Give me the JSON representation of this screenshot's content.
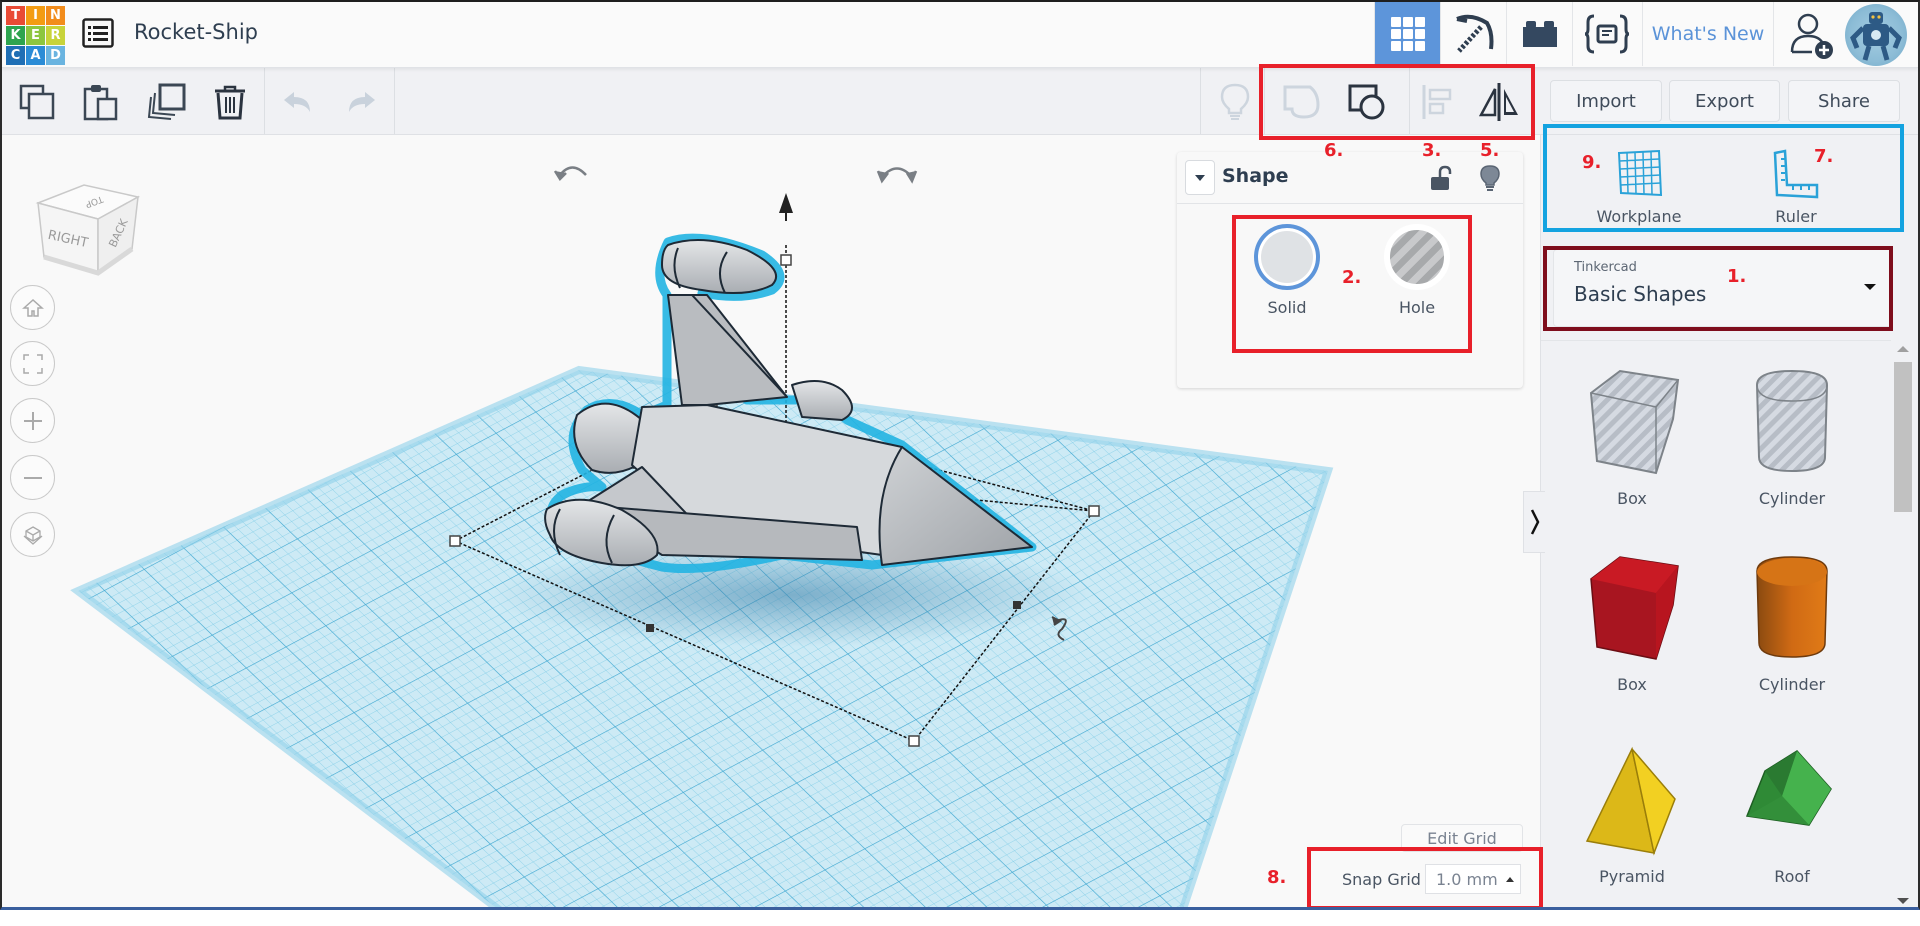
{
  "app": {
    "logo_letters": [
      "T",
      "I",
      "N",
      "K",
      "E",
      "R",
      "C",
      "A",
      "D"
    ],
    "logo_colors": [
      "#e94b35",
      "#f39c12",
      "#f28c1b",
      "#2ea44f",
      "#8dc63f",
      "#c8d33a",
      "#1f6fb5",
      "#2b8cd6",
      "#6ab4e0"
    ],
    "design_title": "Rocket-Ship"
  },
  "topbar": {
    "views": [
      {
        "name": "3d-design",
        "icon": "grid-icon",
        "active": true
      },
      {
        "name": "build-mode",
        "icon": "pickaxe-icon",
        "active": false
      },
      {
        "name": "bricks",
        "icon": "brick-icon",
        "active": false
      },
      {
        "name": "codeblocks",
        "icon": "code-icon",
        "active": false
      }
    ],
    "whats_new": "What's New",
    "accent": "#5d95da"
  },
  "toolbar": {
    "left_tools": [
      "copy",
      "paste",
      "duplicate",
      "delete",
      "undo",
      "redo"
    ],
    "right_tools": [
      "show-all",
      "group",
      "ungroup",
      "align",
      "mirror"
    ],
    "import_label": "Import",
    "export_label": "Export",
    "share_label": "Share"
  },
  "view_cube": {
    "faces": [
      "TOP",
      "RIGHT",
      "BACK"
    ]
  },
  "nav_controls": [
    "home",
    "fit-all",
    "zoom-in",
    "zoom-out",
    "perspective"
  ],
  "shape_panel": {
    "title": "Shape",
    "solid_label": "Solid",
    "hole_label": "Hole",
    "selected": "Solid"
  },
  "right_panel": {
    "workplane_label": "Workplane",
    "ruler_label": "Ruler",
    "library_provider": "Tinkercad",
    "library_name": "Basic Shapes",
    "shapes": [
      {
        "label": "Box",
        "kind": "box-hole"
      },
      {
        "label": "Cylinder",
        "kind": "cylinder-hole"
      },
      {
        "label": "Box",
        "kind": "box",
        "color": "#c4161c"
      },
      {
        "label": "Cylinder",
        "kind": "cylinder",
        "color": "#e07b17"
      },
      {
        "label": "Pyramid",
        "kind": "pyramid",
        "color": "#f2d022"
      },
      {
        "label": "Roof",
        "kind": "roof",
        "color": "#3aa74a"
      }
    ]
  },
  "grid": {
    "edit_grid_label": "Edit Grid",
    "snap_label": "Snap Grid",
    "snap_value": "1.0 mm"
  },
  "annotations": {
    "a1": "1.",
    "a2": "2.",
    "a3": "3.",
    "a5": "5.",
    "a6": "6.",
    "a7": "7.",
    "a8": "8.",
    "a9": "9."
  }
}
